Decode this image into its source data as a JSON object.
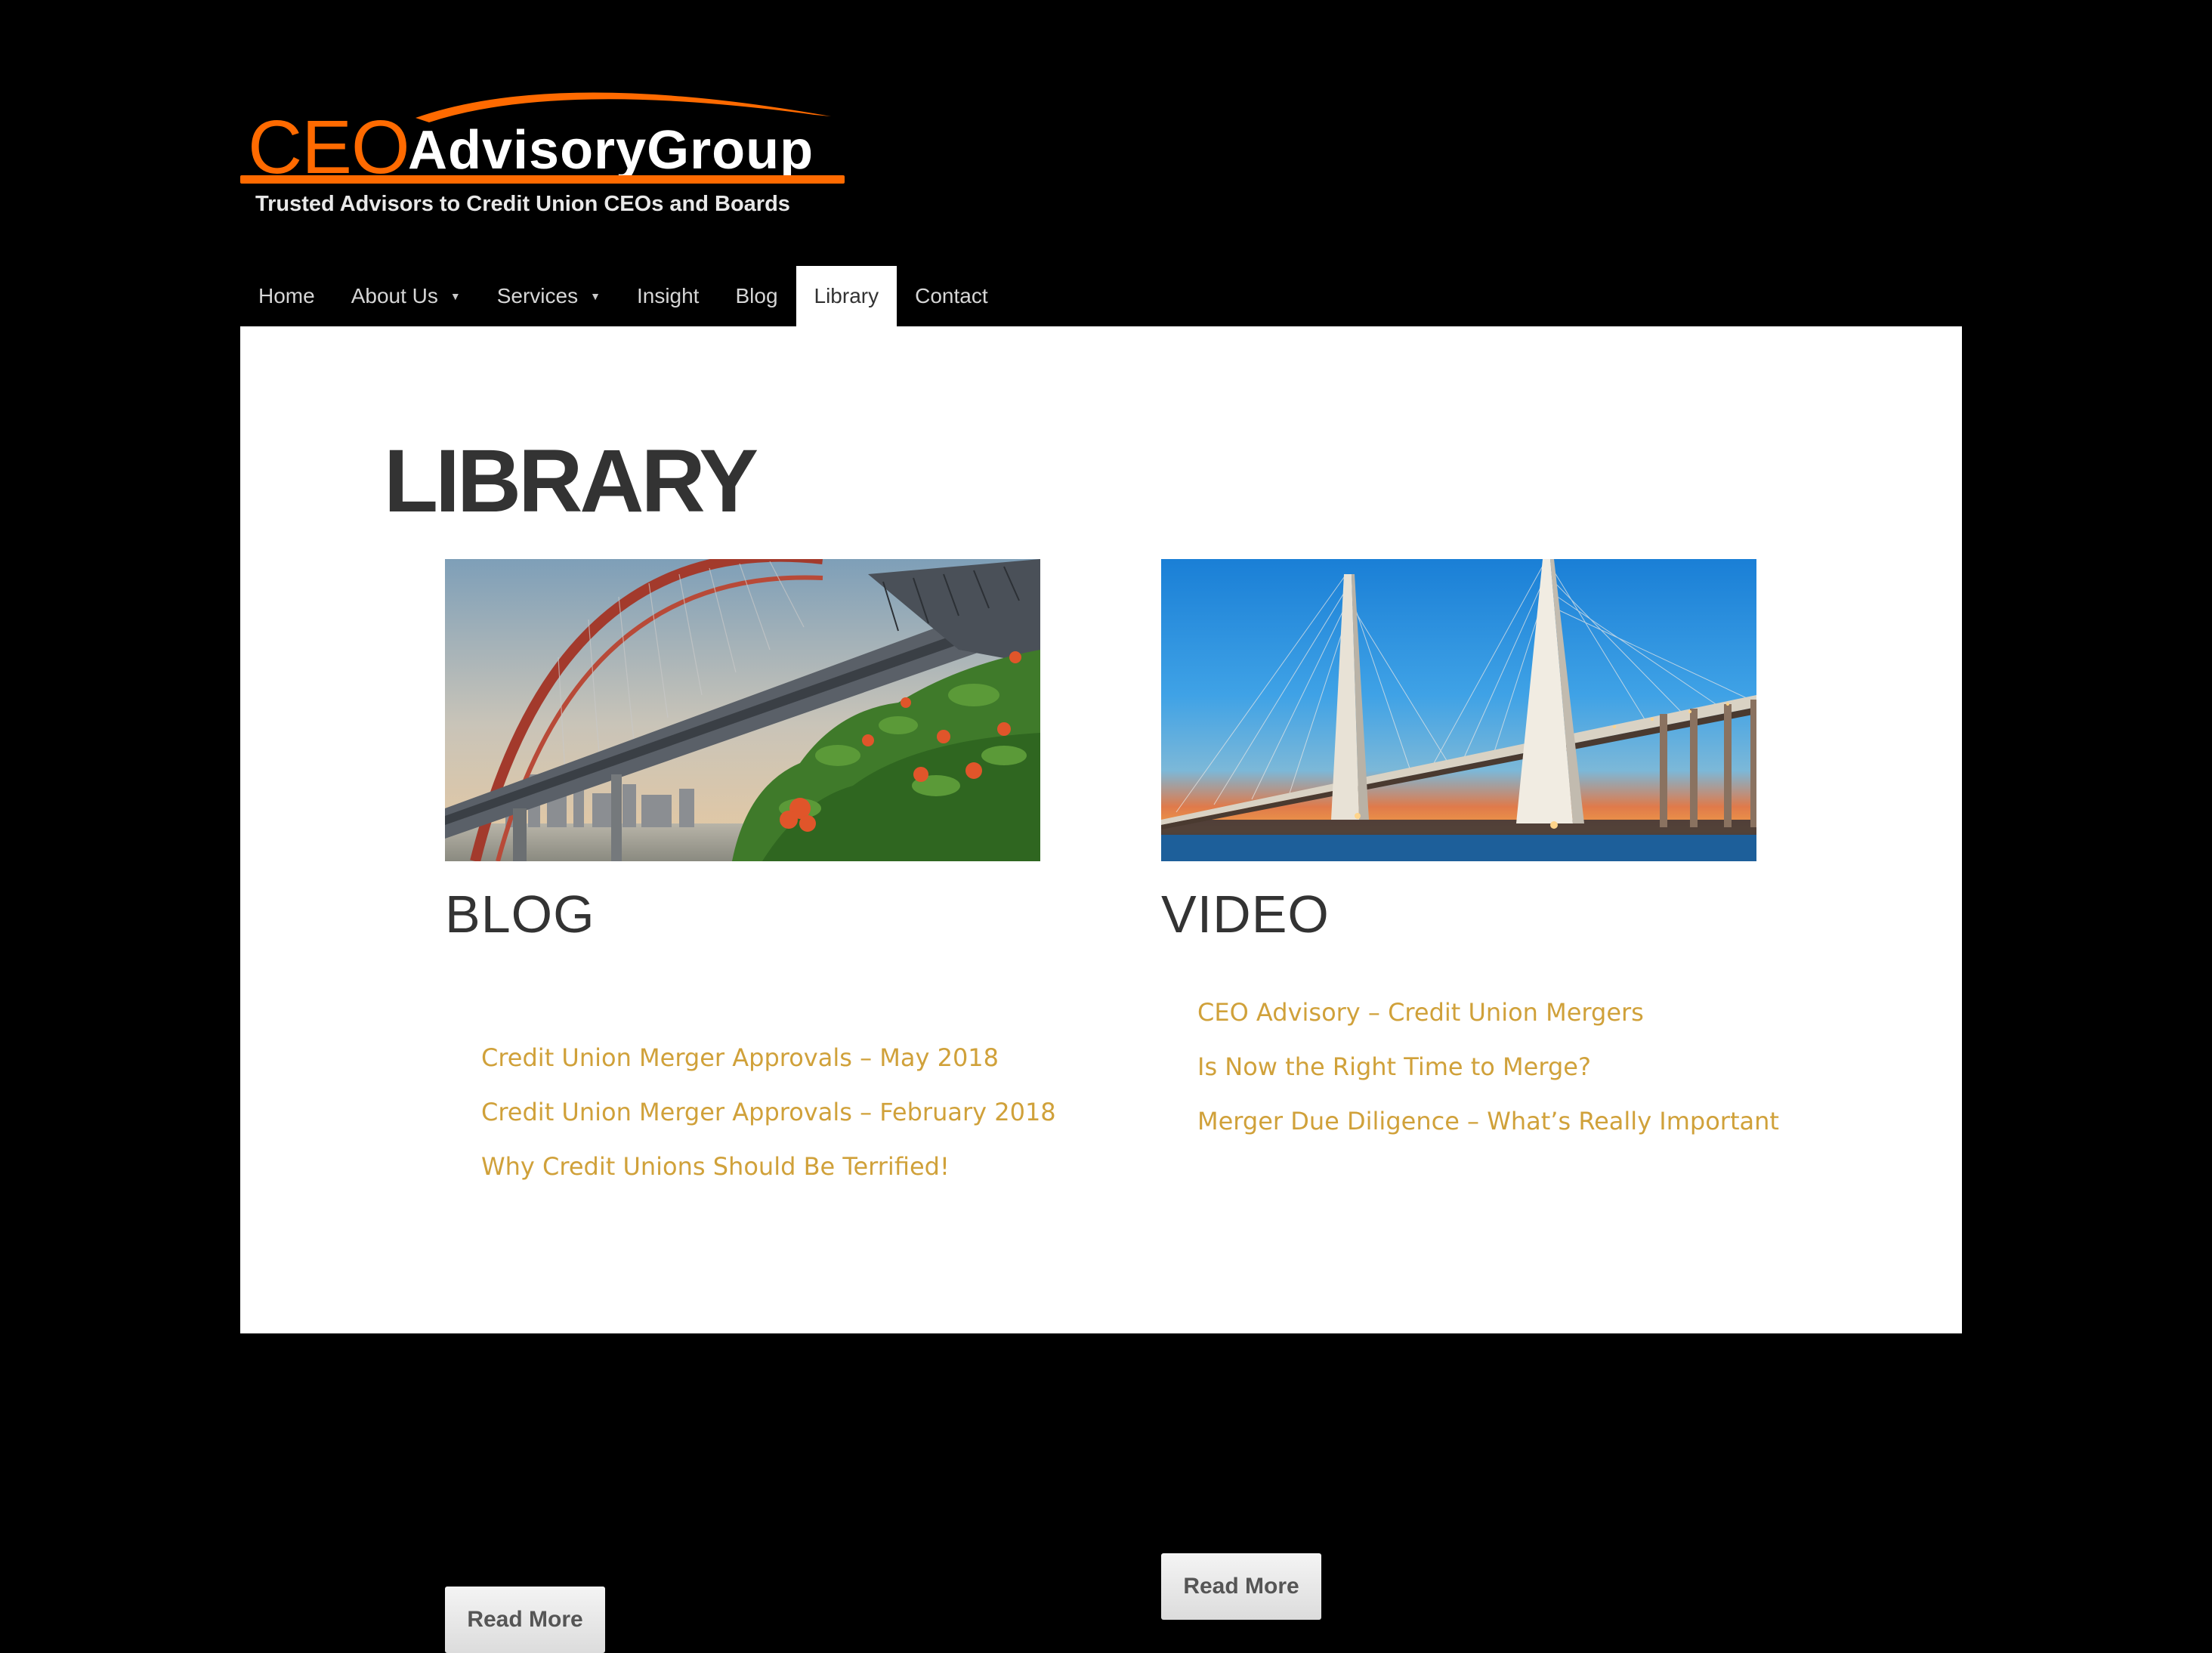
{
  "logo": {
    "ceo": "CEO",
    "group": "AdvisoryGroup",
    "tagline": "Trusted Advisors to Credit Union CEOs and Boards"
  },
  "nav": {
    "items": [
      {
        "label": "Home",
        "has_dropdown": false,
        "active": false
      },
      {
        "label": "About Us",
        "has_dropdown": true,
        "active": false
      },
      {
        "label": "Services",
        "has_dropdown": true,
        "active": false
      },
      {
        "label": "Insight",
        "has_dropdown": false,
        "active": false
      },
      {
        "label": "Blog",
        "has_dropdown": false,
        "active": false
      },
      {
        "label": "Library",
        "has_dropdown": false,
        "active": true
      },
      {
        "label": "Contact",
        "has_dropdown": false,
        "active": false
      }
    ],
    "caret_icon": "chevron-down-icon"
  },
  "page": {
    "title": "LIBRARY"
  },
  "sections": {
    "blog": {
      "heading": "BLOG",
      "links": [
        "Credit Union Merger Approvals – May 2018",
        "Credit Union Merger Approvals – February 2018",
        "Why Credit Unions Should Be Terrified!"
      ],
      "button": "Read More"
    },
    "video": {
      "heading": "VIDEO",
      "links": [
        "CEO Advisory – Credit Union Mergers",
        "Is Now the Right Time to Merge?",
        "Merger Due Diligence – What’s Really Important"
      ],
      "button": "Read More"
    }
  },
  "colors": {
    "page_background": "#000000",
    "panel_background": "#ffffff",
    "brand_orange": "#ff6a00",
    "link_gold": "#d0a13a",
    "heading_text": "#333333",
    "nav_text": "#d6d6d6"
  }
}
